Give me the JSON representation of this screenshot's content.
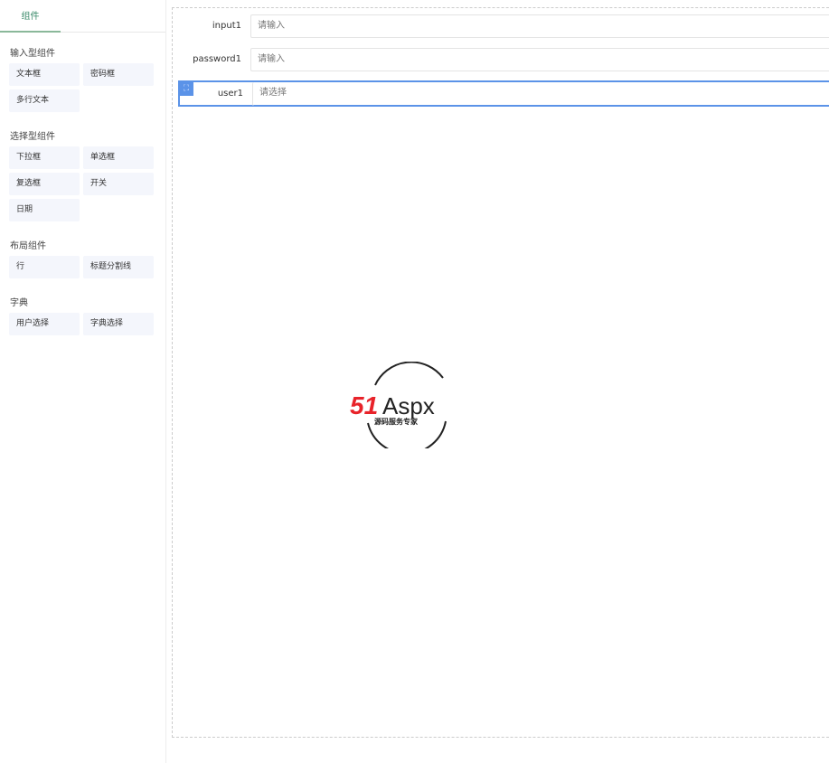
{
  "sidebar": {
    "tab": "组件",
    "groups": [
      {
        "title": "输入型组件",
        "items": [
          "文本框",
          "密码框",
          "多行文本"
        ]
      },
      {
        "title": "选择型组件",
        "items": [
          "下拉框",
          "单选框",
          "复选框",
          "开关",
          "日期"
        ]
      },
      {
        "title": "布局组件",
        "items": [
          "行",
          "标题分割线"
        ]
      },
      {
        "title": "字典",
        "items": [
          "用户选择",
          "字典选择"
        ]
      }
    ]
  },
  "form": {
    "fields": [
      {
        "label": "input1",
        "placeholder": "请输入"
      },
      {
        "label": "password1",
        "placeholder": "请输入"
      },
      {
        "label": "user1",
        "placeholder": "请选择"
      }
    ]
  },
  "watermark": {
    "brand": "51Aspx",
    "slogan": "源码服务专家"
  },
  "colors": {
    "accent": "#5b93e8",
    "tab": "#3a8a6a",
    "logo_red": "#e8232a",
    "logo_green": "#2aa53a"
  }
}
